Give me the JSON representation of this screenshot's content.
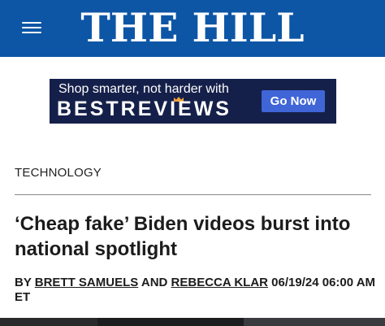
{
  "header": {
    "logo_text": "THE HILL",
    "menu_icon": "hamburger-menu-icon",
    "background_color": "#0d56a6"
  },
  "ad": {
    "tagline": "Shop smarter, not harder with",
    "brand": "BESTREVIEWS",
    "cta_label": "Go Now",
    "background_color": "#15204a",
    "cta_color": "#3f65d7",
    "accent_color": "#f2a33a"
  },
  "article": {
    "section": "TECHNOLOGY",
    "headline": "‘Cheap fake’ Biden videos burst into national spotlight",
    "byline": {
      "prefix": "BY",
      "author1": "BRETT SAMUELS",
      "conjunction": "AND",
      "author2": "REBECCA KLAR",
      "timestamp": "06/19/24 06:00 AM ET"
    }
  }
}
